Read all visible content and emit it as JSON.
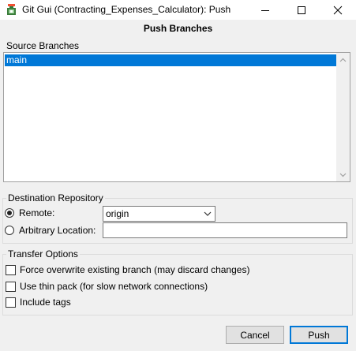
{
  "window": {
    "title": "Git Gui (Contracting_Expenses_Calculator): Push",
    "icon": "git-gui-icon",
    "controls": [
      "minimize-icon",
      "maximize-icon",
      "close-icon"
    ]
  },
  "heading": "Push Branches",
  "source": {
    "label": "Source Branches",
    "branches": [
      "main"
    ],
    "selected": "main"
  },
  "destination": {
    "label": "Destination Repository",
    "remote_label": "Remote:",
    "remote_value": "origin",
    "remote_selected": true,
    "arbitrary_label": "Arbitrary Location:",
    "arbitrary_value": ""
  },
  "transfer": {
    "label": "Transfer Options",
    "options": [
      {
        "label": "Force overwrite existing branch (may discard changes)",
        "checked": false
      },
      {
        "label": "Use thin pack (for slow network connections)",
        "checked": false
      },
      {
        "label": "Include tags",
        "checked": false
      }
    ]
  },
  "buttons": {
    "cancel": "Cancel",
    "push": "Push"
  },
  "colors": {
    "selection": "#0078d7",
    "background": "#f0f0f0",
    "default_button_border": "#0078d7"
  }
}
